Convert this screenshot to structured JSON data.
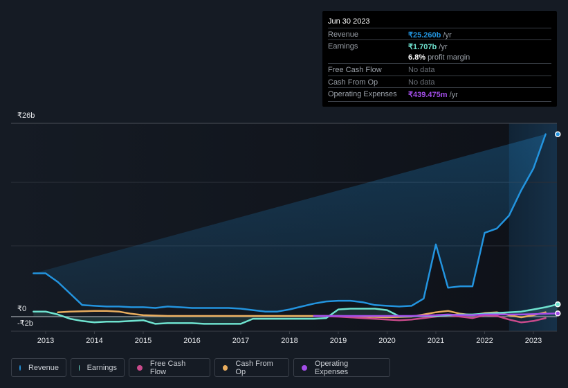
{
  "tooltip": {
    "date": "Jun 30 2023",
    "rows": [
      {
        "label": "Revenue",
        "value": "₹25.260b",
        "unit": " /yr",
        "color": "#2394df"
      },
      {
        "label": "Earnings",
        "value": "₹1.707b",
        "unit": " /yr",
        "color": "#6fe3d0"
      },
      {
        "label": "",
        "value": "6.8%",
        "unit": " profit margin",
        "color": "#ffffff"
      },
      {
        "label": "Free Cash Flow",
        "value": "No data",
        "unit": "",
        "color": "#6b7078"
      },
      {
        "label": "Cash From Op",
        "value": "No data",
        "unit": "",
        "color": "#6b7078"
      },
      {
        "label": "Operating Expenses",
        "value": "₹439.475m",
        "unit": " /yr",
        "color": "#a24de8"
      }
    ]
  },
  "legend": [
    {
      "label": "Revenue",
      "color": "#2394df"
    },
    {
      "label": "Earnings",
      "color": "#6fe3d0"
    },
    {
      "label": "Free Cash Flow",
      "color": "#c84a8b"
    },
    {
      "label": "Cash From Op",
      "color": "#e8ad5e"
    },
    {
      "label": "Operating Expenses",
      "color": "#a24de8"
    }
  ],
  "chart_data": {
    "type": "line",
    "title": "",
    "xlabel": "",
    "ylabel": "",
    "y_tick_labels": [
      "₹26b",
      "₹0",
      "-₹2b"
    ],
    "x_tick_labels": [
      "2013",
      "2014",
      "2015",
      "2016",
      "2017",
      "2018",
      "2019",
      "2020",
      "2021",
      "2022",
      "2023"
    ],
    "ylim": [
      -2,
      26
    ],
    "xlim": [
      2012.3,
      2023.5
    ],
    "grid": true,
    "highlight_region": [
      2022.5,
      2023.5
    ],
    "series": [
      {
        "name": "Revenue",
        "color": "#2394df",
        "x": [
          2012.75,
          2013.0,
          2013.25,
          2013.5,
          2013.75,
          2014.0,
          2014.25,
          2014.5,
          2014.75,
          2015.0,
          2015.25,
          2015.5,
          2015.75,
          2016.0,
          2016.25,
          2016.5,
          2016.75,
          2017.0,
          2017.25,
          2017.5,
          2017.75,
          2018.0,
          2018.25,
          2018.5,
          2018.75,
          2019.0,
          2019.25,
          2019.5,
          2019.75,
          2020.0,
          2020.25,
          2020.5,
          2020.75,
          2021.0,
          2021.25,
          2021.5,
          2021.75,
          2022.0,
          2022.25,
          2022.5,
          2022.75,
          2023.0,
          2023.25,
          2023.5
        ],
        "values": [
          6.0,
          6.0,
          4.8,
          3.2,
          1.6,
          1.5,
          1.4,
          1.4,
          1.3,
          1.3,
          1.2,
          1.4,
          1.3,
          1.2,
          1.2,
          1.2,
          1.2,
          1.1,
          0.9,
          0.7,
          0.7,
          1.0,
          1.4,
          1.8,
          2.1,
          2.2,
          2.2,
          2.0,
          1.6,
          1.5,
          1.4,
          1.5,
          2.5,
          10.0,
          4.0,
          4.2,
          4.2,
          11.6,
          12.2,
          14.0,
          17.5,
          20.5,
          25.26
        ]
      },
      {
        "name": "Earnings",
        "color": "#6fe3d0",
        "x": [
          2012.75,
          2013.0,
          2013.25,
          2013.5,
          2013.75,
          2014.0,
          2014.25,
          2014.5,
          2014.75,
          2015.0,
          2015.25,
          2015.5,
          2015.75,
          2016.0,
          2016.25,
          2016.5,
          2016.75,
          2017.0,
          2017.25,
          2017.5,
          2017.75,
          2018.0,
          2018.25,
          2018.5,
          2018.75,
          2019.0,
          2019.25,
          2019.5,
          2019.75,
          2020.0,
          2020.25,
          2020.5,
          2020.75,
          2021.0,
          2021.25,
          2021.5,
          2021.75,
          2022.0,
          2022.25,
          2022.5,
          2022.75,
          2023.0,
          2023.25,
          2023.5
        ],
        "values": [
          0.7,
          0.7,
          0.3,
          -0.3,
          -0.6,
          -0.8,
          -0.7,
          -0.7,
          -0.6,
          -0.5,
          -1.0,
          -0.9,
          -0.9,
          -0.9,
          -1.0,
          -1.0,
          -1.0,
          -1.0,
          -0.3,
          -0.3,
          -0.3,
          -0.3,
          -0.3,
          -0.3,
          -0.2,
          1.0,
          1.1,
          1.1,
          1.1,
          0.9,
          0.05,
          0.05,
          0.1,
          0.1,
          0.2,
          0.3,
          0.3,
          0.4,
          0.5,
          0.6,
          0.7,
          1.0,
          1.3,
          1.707
        ]
      },
      {
        "name": "Free Cash Flow",
        "color": "#c84a8b",
        "x": [
          2018.5,
          2019.0,
          2019.5,
          2020.0,
          2020.25,
          2020.5,
          2020.75,
          2021.0,
          2021.25,
          2021.5,
          2021.75,
          2022.0,
          2022.25,
          2022.5,
          2022.75,
          2023.0,
          2023.25
        ],
        "values": [
          0.1,
          0.0,
          -0.2,
          -0.4,
          -0.5,
          -0.4,
          -0.2,
          0.0,
          0.2,
          0.0,
          -0.2,
          0.2,
          0.1,
          -0.4,
          -0.8,
          -0.6,
          -0.2
        ]
      },
      {
        "name": "Cash From Op",
        "color": "#e8ad5e",
        "x": [
          2013.25,
          2013.5,
          2014.0,
          2014.25,
          2014.5,
          2014.75,
          2015.0,
          2015.5,
          2016.0,
          2016.5,
          2017.0,
          2017.5,
          2018.0,
          2018.5,
          2019.0,
          2019.5,
          2020.0,
          2020.5,
          2020.75,
          2021.0,
          2021.25,
          2021.5,
          2021.75,
          2022.0,
          2022.25,
          2022.5,
          2022.75,
          2023.0,
          2023.25
        ],
        "values": [
          0.6,
          0.7,
          0.8,
          0.8,
          0.7,
          0.4,
          0.2,
          0.1,
          0.1,
          0.1,
          0.1,
          0.1,
          0.1,
          0.1,
          0.1,
          0.0,
          -0.1,
          0.0,
          0.3,
          0.6,
          0.8,
          0.4,
          0.2,
          0.5,
          0.6,
          0.2,
          -0.1,
          0.2,
          0.6
        ]
      },
      {
        "name": "Operating Expenses",
        "color": "#a24de8",
        "x": [
          2018.5,
          2019.0,
          2019.5,
          2020.0,
          2020.5,
          2021.0,
          2021.25,
          2021.5,
          2021.75,
          2022.0,
          2022.25,
          2022.5,
          2022.75,
          2023.0,
          2023.25,
          2023.5
        ],
        "values": [
          0.1,
          0.1,
          0.1,
          0.1,
          0.1,
          0.2,
          0.3,
          0.2,
          0.2,
          0.3,
          0.3,
          0.3,
          0.3,
          0.35,
          0.4,
          0.44
        ]
      }
    ]
  }
}
